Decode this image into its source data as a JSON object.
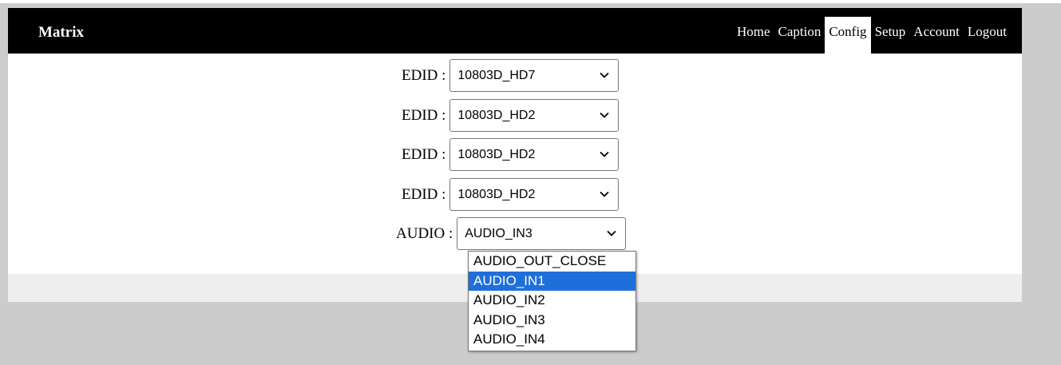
{
  "brand": "Matrix",
  "nav": [
    "Home",
    "Caption",
    "Config",
    "Setup",
    "Account",
    "Logout"
  ],
  "nav_active": "Config",
  "edid_label": "EDID :",
  "edid_values": [
    "10803D_HD7",
    "10803D_HD2",
    "10803D_HD2",
    "10803D_HD2"
  ],
  "audio": {
    "label": "AUDIO :",
    "value": "AUDIO_IN3",
    "options": [
      "AUDIO_OUT_CLOSE",
      "AUDIO_IN1",
      "AUDIO_IN2",
      "AUDIO_IN3",
      "AUDIO_IN4"
    ],
    "highlighted": "AUDIO_IN1"
  },
  "colors": {
    "topbar": "#000000",
    "background": "#cccccc",
    "highlight": "#1e6fdc"
  },
  "icons": {
    "dropdown": "chevron-down-icon"
  }
}
